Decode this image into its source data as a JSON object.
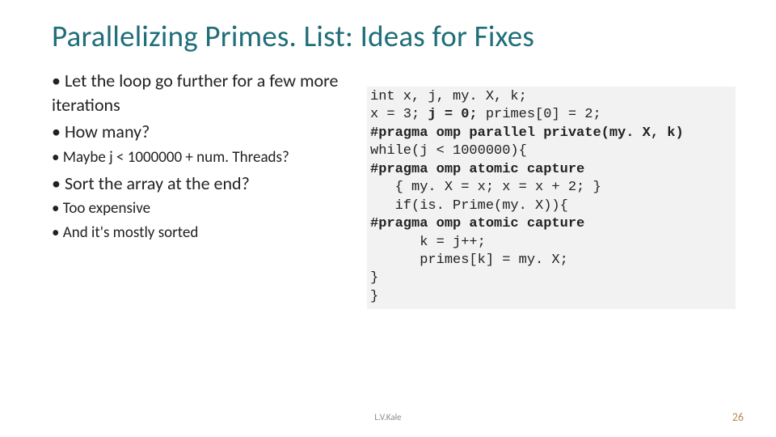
{
  "title": "Parallelizing Primes. List: Ideas for Fixes",
  "bullets": {
    "b1": "Let the loop go further for a few more iterations",
    "b2": "How many?",
    "b2s1": "Maybe j < 1000000 + num. Threads?",
    "b3": "Sort the array at the end?",
    "b3s1": "Too expensive",
    "b3s2": "And it's mostly sorted"
  },
  "code": {
    "l1a": "int x, j, my. X, k;",
    "l2a": "x = 3; ",
    "l2b": "j = 0;",
    "l2c": " primes[0] = 2;",
    "l3": "#pragma omp parallel private(my. X, k)",
    "l4": "while(j < 1000000){",
    "l5": "#pragma omp atomic capture",
    "l6": "   { my. X = x; x = x + 2; }",
    "l7": "   if(is. Prime(my. X)){",
    "l8": "#pragma omp atomic capture",
    "l9": "      k = j++;",
    "l10": "      primes[k] = my. X;",
    "l11": "}",
    "l12": "}"
  },
  "footer": {
    "author": "L.V.Kale",
    "page": "26"
  }
}
